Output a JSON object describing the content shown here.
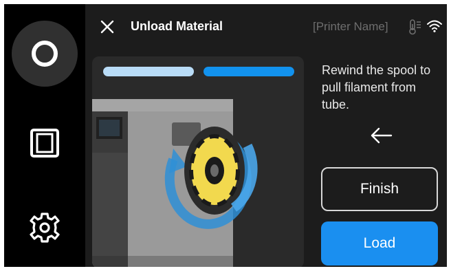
{
  "header": {
    "title": "Unload Material",
    "printer_name": "[Printer Name]"
  },
  "sidebar": {
    "items": [
      {
        "icon": "circle-icon",
        "active": true
      },
      {
        "icon": "device-icon",
        "active": false
      },
      {
        "icon": "gear-icon",
        "active": false
      }
    ]
  },
  "progress": {
    "steps_total": 2,
    "current_step": 2,
    "colors": {
      "done": "#b9dcf7",
      "active": "#1292ee"
    }
  },
  "instruction": {
    "text": "Rewind the spool to pull filament from tube."
  },
  "buttons": {
    "finish_label": "Finish",
    "load_label": "Load"
  },
  "colors": {
    "accent": "#1a8ff0",
    "panel_bg": "#1c1c1c",
    "sidebar_bg": "#000000",
    "filament": "#f2d94e"
  },
  "icons": {
    "close": "close-icon",
    "temperature": "thermometer-icon",
    "wifi": "wifi-icon",
    "arrow": "arrow-left-icon"
  }
}
